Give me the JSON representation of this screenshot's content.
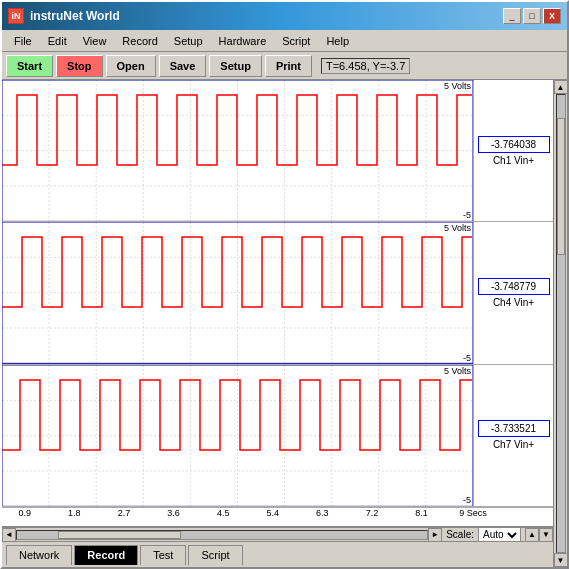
{
  "window": {
    "title": "instruNet World",
    "icon": "iN"
  },
  "window_controls": {
    "minimize": "_",
    "maximize": "□",
    "close": "X"
  },
  "menu": {
    "items": [
      "File",
      "Edit",
      "View",
      "Record",
      "Setup",
      "Hardware",
      "Script",
      "Help"
    ]
  },
  "toolbar": {
    "start": "Start",
    "stop": "Stop",
    "open": "Open",
    "save": "Save",
    "setup": "Setup",
    "print": "Print",
    "status": "T=6.458, Y=-3.7"
  },
  "charts": [
    {
      "volt_top": "5 Volts",
      "volt_bot": "-5",
      "value": "-3.764038",
      "channel": "Ch1 Vin+"
    },
    {
      "volt_top": "5 Volts",
      "volt_bot": "-5",
      "value": "-3.748779",
      "channel": "Ch4 Vin+"
    },
    {
      "volt_top": "5 Volts",
      "volt_bot": "-5",
      "value": "-3.733521",
      "channel": "Ch7 Vin+"
    }
  ],
  "x_axis": {
    "ticks": [
      "0.9",
      "1.8",
      "2.7",
      "3.6",
      "4.5",
      "5.4",
      "6.3",
      "7.2",
      "8.1",
      "9 Secs"
    ]
  },
  "scale": {
    "label": "Scale:",
    "value": "Auto"
  },
  "tabs": [
    "Network",
    "Record",
    "Test",
    "Script"
  ],
  "active_tab": "Record"
}
